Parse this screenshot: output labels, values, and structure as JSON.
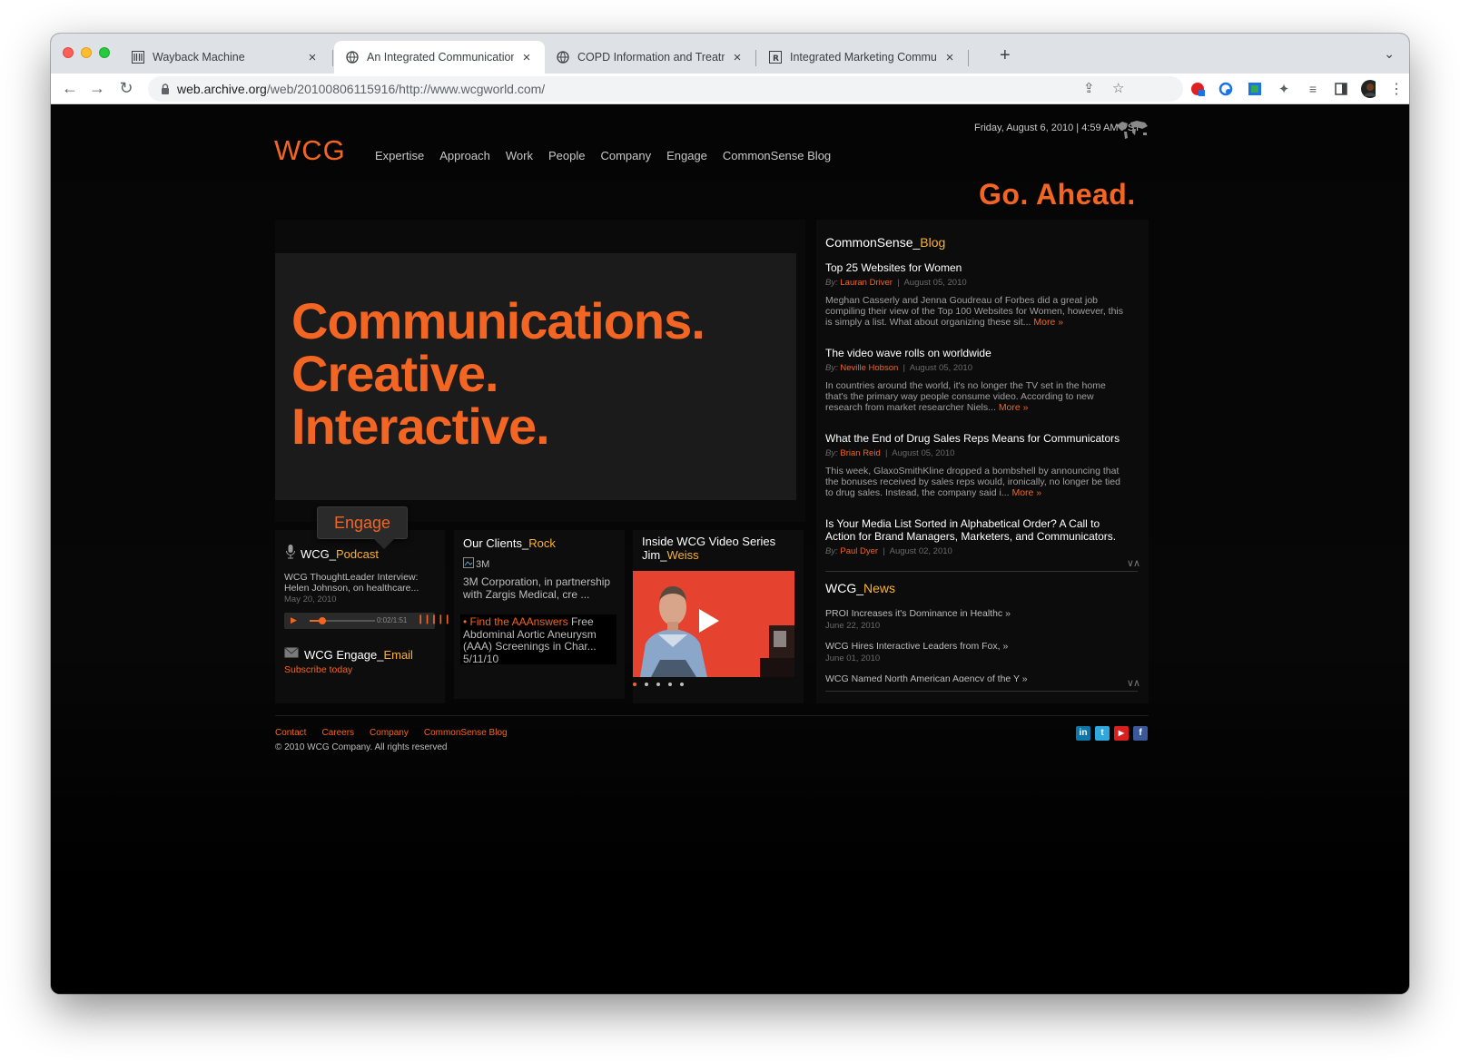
{
  "browser": {
    "tabs": [
      {
        "title": "Wayback Machine",
        "icon": "wayback-icon"
      },
      {
        "title": "An Integrated Communications",
        "icon": "globe-icon"
      },
      {
        "title": "COPD Information and Treatme",
        "icon": "globe-icon"
      },
      {
        "title": "Integrated Marketing Communi",
        "icon": "r-box-icon"
      }
    ],
    "url_host": "web.archive.org",
    "url_path": "/web/20100806115916/http://www.wcgworld.com/"
  },
  "site": {
    "logo": "WCG",
    "nav": [
      "Expertise",
      "Approach",
      "Work",
      "People",
      "Company",
      "Engage",
      "CommonSense Blog"
    ],
    "date": "Friday, August 6, 2010 | 4:59 AM PST",
    "tagline": "Go. Ahead.",
    "hero": [
      "Communications.",
      "Creative.",
      "Interactive."
    ]
  },
  "engage": {
    "tab_label": "Engage",
    "podcast_title": "WCG_",
    "podcast_accent": "Podcast",
    "podcast_text": "WCG ThoughtLeader Interview: Helen Johnson, on healthcare...",
    "podcast_date": "May 20, 2010",
    "player_time": "0:02/1:51",
    "player_progress": 0.02,
    "email_title": "WCG Engage_",
    "email_accent": "Email",
    "subscribe": "Subscribe today"
  },
  "clients": {
    "title": "Our Clients_",
    "accent": "Rock",
    "img_alt": "3M",
    "text": "3M Corporation, in partnership with Zargis Medical, cre ...",
    "link_bullet": "•",
    "link": "Find the AAAnswers",
    "link_rest": " Free Abdominal Aortic Aneurysm (AAA) Screenings in Char...",
    "link_date": "5/11/10"
  },
  "video": {
    "title": "Inside WCG Video Series",
    "name": "Jim_",
    "name_accent": "Weiss",
    "slides": 5,
    "active_slide": 0
  },
  "blog": {
    "heading": "CommonSense_",
    "heading_accent": "Blog",
    "posts": [
      {
        "title": "Top 25 Websites for Women",
        "by": "By:",
        "author": "Lauran Driver",
        "date": "August 05, 2010",
        "body": "Meghan Casserly and Jenna Goudreau of Forbes did a great job compiling their view of the Top 100 Websites for Women, however, this is simply a list. What about organizing these sit...",
        "more": "More »"
      },
      {
        "title": "The video wave rolls on worldwide",
        "by": "By:",
        "author": "Neville Hobson",
        "date": "August 05, 2010",
        "body": "In countries around the world, it's no longer the TV set in the home that's the primary way people consume video. According to new research from market researcher Niels...",
        "more": "More »"
      },
      {
        "title": "What the End of Drug Sales Reps Means for Communicators",
        "by": "By:",
        "author": "Brian Reid",
        "date": "August 05, 2010",
        "body": "This week, GlaxoSmithKline dropped a bombshell by announcing that the bonuses received by sales reps would, ironically, no longer be tied to drug sales. Instead, the company said i...",
        "more": "More »"
      },
      {
        "title": "Is Your Media List Sorted in Alphabetical Order? A Call to Action for Brand Managers, Marketers, and Communicators.",
        "by": "By:",
        "author": "Paul Dyer",
        "date": "August 02, 2010",
        "body": "",
        "more": ""
      }
    ],
    "updown": "∨∧"
  },
  "news": {
    "heading": "WCG_",
    "heading_accent": "News",
    "items": [
      {
        "title": "PROI Increases it's Dominance in Healthc »",
        "date": "June 22, 2010"
      },
      {
        "title": "WCG Hires Interactive Leaders from Fox, »",
        "date": "June 01, 2010"
      },
      {
        "title": "WCG Named North American Agency of the Y »",
        "date": ""
      }
    ]
  },
  "footer": {
    "links": [
      "Contact",
      "Careers",
      "Company",
      "CommonSense Blog"
    ],
    "copyright": "© 2010 WCG Company. All rights reserved",
    "social": [
      {
        "name": "linkedin-icon",
        "label": "in",
        "color": "#0e76a8"
      },
      {
        "name": "twitter-icon",
        "label": "t",
        "color": "#2fa8e0"
      },
      {
        "name": "youtube-icon",
        "label": "▶",
        "color": "#d8201f"
      },
      {
        "name": "facebook-icon",
        "label": "f",
        "color": "#3b5998"
      }
    ]
  },
  "colors": {
    "accent": "#f26522",
    "accent2": "#f9b233",
    "bg": "#000000"
  }
}
